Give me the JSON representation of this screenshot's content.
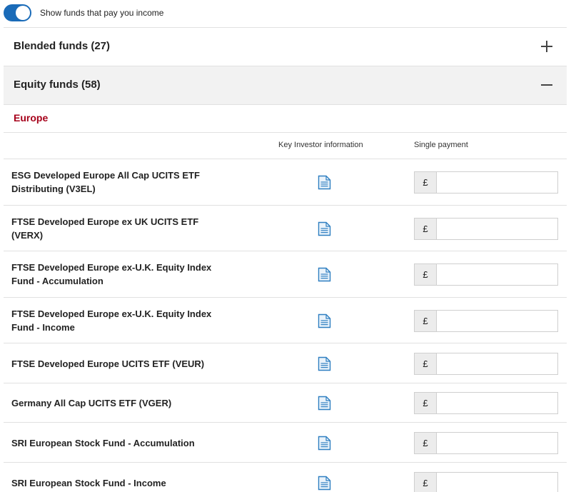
{
  "toggle": {
    "label": "Show funds that pay you income",
    "on": true
  },
  "sections": [
    {
      "title": "Blended funds (27)",
      "expanded": false
    },
    {
      "title": "Equity funds (58)",
      "expanded": true
    }
  ],
  "region": "Europe",
  "columns": {
    "kii": "Key Investor information",
    "payment": "Single payment"
  },
  "currency_symbol": "£",
  "funds": [
    {
      "name": "ESG Developed Europe All Cap UCITS ETF Distributing (V3EL)",
      "amount": ""
    },
    {
      "name": "FTSE Developed Europe ex UK UCITS ETF (VERX)",
      "amount": ""
    },
    {
      "name": "FTSE Developed Europe ex-U.K. Equity Index Fund - Accumulation",
      "amount": ""
    },
    {
      "name": "FTSE Developed Europe ex-U.K. Equity Index Fund - Income",
      "amount": ""
    },
    {
      "name": "FTSE Developed Europe UCITS ETF (VEUR)",
      "amount": ""
    },
    {
      "name": "Germany All Cap UCITS ETF (VGER)",
      "amount": ""
    },
    {
      "name": "SRI European Stock Fund - Accumulation",
      "amount": ""
    },
    {
      "name": "SRI European Stock Fund - Income",
      "amount": ""
    }
  ],
  "colors": {
    "accent": "#1a6bb8",
    "region": "#a6001a",
    "doc_icon": "#2f7fc1"
  },
  "icons": {
    "document": "document-icon",
    "expand": "plus-icon",
    "collapse": "minus-icon"
  }
}
